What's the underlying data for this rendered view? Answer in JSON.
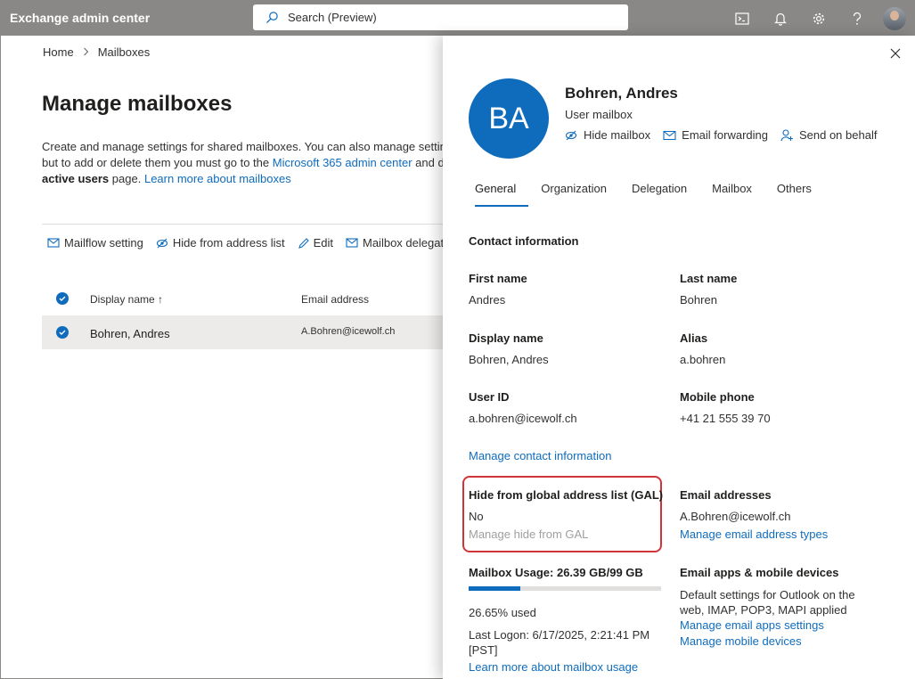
{
  "topbar": {
    "app_title": "Exchange admin center",
    "search_placeholder": "Search (Preview)"
  },
  "breadcrumb": {
    "home": "Home",
    "current": "Mailboxes"
  },
  "page": {
    "title": "Manage mailboxes",
    "desc_line1": "Create and manage settings for shared mailboxes. You can also manage settings for user mailboxes,",
    "desc_line2_a": "but to add or delete them you must go to the",
    "desc_link_admin": "Microsoft 365 admin center",
    "desc_line2_b": "and do it from the",
    "desc_bold": "active users",
    "desc_line3_b": "page.",
    "desc_link_learn": "Learn more about mailboxes"
  },
  "commands": {
    "mailflow": "Mailflow setting",
    "hide": "Hide from address list",
    "edit": "Edit",
    "delegation": "Mailbox delegation"
  },
  "grid": {
    "col_display": "Display name",
    "sort_arrow": "↑",
    "col_email": "Email address",
    "rows": [
      {
        "display": "Bohren, Andres",
        "email": "A.Bohren@icewolf.ch"
      }
    ]
  },
  "panel": {
    "initials": "BA",
    "name": "Bohren, Andres",
    "type": "User mailbox",
    "actions": {
      "hide": "Hide mailbox",
      "forwarding": "Email forwarding",
      "behalf": "Send on behalf"
    },
    "tabs": [
      "General",
      "Organization",
      "Delegation",
      "Mailbox",
      "Others"
    ],
    "contact_title": "Contact information",
    "first_name_label": "First name",
    "first_name": "Andres",
    "last_name_label": "Last name",
    "last_name": "Bohren",
    "display_name_label": "Display name",
    "display_name": "Bohren, Andres",
    "alias_label": "Alias",
    "alias": "a.bohren",
    "user_id_label": "User ID",
    "user_id": "a.bohren@icewolf.ch",
    "mobile_label": "Mobile phone",
    "mobile": "+41 21 555 39 70",
    "manage_contact": "Manage contact information",
    "gal_label": "Hide from global address list (GAL)",
    "gal_value": "No",
    "gal_manage": "Manage hide from GAL",
    "email_addr_label": "Email addresses",
    "email_addr": "A.Bohren@icewolf.ch",
    "email_addr_manage": "Manage email address types",
    "usage_label": "Mailbox Usage: 26.39 GB/99 GB",
    "usage_fraction": 0.2665,
    "usage_percent": "26.65% used",
    "last_logon": "Last Logon: 6/17/2025, 2:21:41 PM [PST]",
    "usage_learn": "Learn more about mailbox usage",
    "apps_label": "Email apps & mobile devices",
    "apps_text": "Default settings for Outlook on the web, IMAP, POP3, MAPI applied",
    "apps_manage": "Manage email apps settings",
    "mobile_manage": "Manage mobile devices"
  },
  "colors": {
    "accent": "#0f6cbd",
    "highlight": "#d13438",
    "topbar": "#8a8886"
  }
}
